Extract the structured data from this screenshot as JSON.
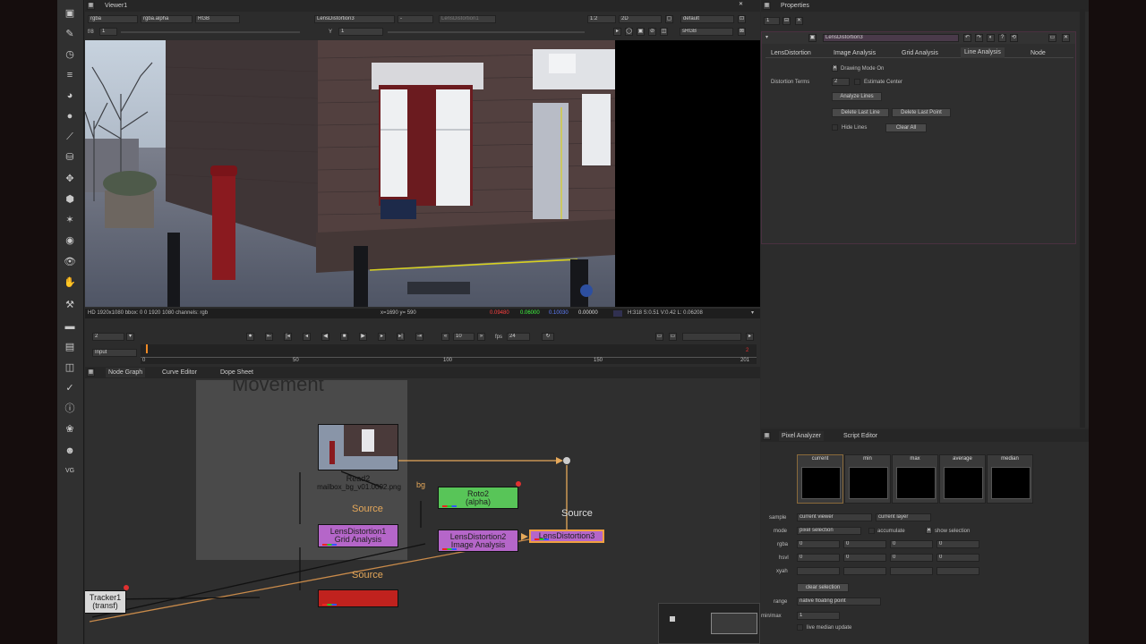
{
  "viewer": {
    "tab": "Viewer1",
    "channels": "rgba",
    "alpha": "rgba.alpha",
    "colorspace": "RGB",
    "input_a": "LensDistortion3",
    "input_b": "-",
    "input_b2": "LensDistortion1",
    "zoom": "1:2",
    "frames": "2D",
    "lut": "default",
    "gain_label": "f/8",
    "gain_value": "1",
    "gamma_label": "Y",
    "gamma_value": "1",
    "viewer_lut": "sRGB",
    "info_format": "HD 1920x1080  bbox: 0 0 1920 1080  channels: rgb",
    "info_coords": "x=1690 y= 590",
    "info_r": "0.09480",
    "info_g": "0.06000",
    "info_b": "0.10030",
    "info_a": "0.00000",
    "info_hsvl": "H:318 S:0.51 V:0.42  L: 0.06208"
  },
  "timeline": {
    "frame": "2",
    "playback_fps_label": "fps",
    "fps": "24",
    "increment": "10",
    "range_mode": "Input",
    "ticks": [
      "0",
      "50",
      "100",
      "150",
      "201"
    ],
    "end_frame": "2",
    "end_frame2": "201"
  },
  "node_panel": {
    "tabs": [
      "Node Graph",
      "Curve Editor",
      "Dope Sheet"
    ],
    "backdrop_label": "Movement",
    "nodes": {
      "read2_label": "Read2",
      "read2_file": "mailbox_bg_v01.0002.png",
      "roto2_name": "Roto2",
      "roto2_sub": "(alpha)",
      "lens1_name": "LensDistortion1",
      "lens1_sub": "Grid Analysis",
      "lens2_name": "LensDistortion2",
      "lens2_sub": "Image Analysis",
      "lens3_name": "LensDistortion3",
      "tracker1_name": "Tracker1",
      "tracker1_sub": "(transf)"
    },
    "edge_labels": {
      "source1": "Source",
      "source2": "Source",
      "source3": "Source",
      "bg": "bg"
    }
  },
  "properties": {
    "title": "Properties",
    "count": "1",
    "node_name": "LensDistortion3",
    "tabs": [
      "LensDistortion",
      "Image Analysis",
      "Grid Analysis",
      "Line Analysis",
      "Node"
    ],
    "active_tab": "Line Analysis",
    "drawing_mode": "Drawing Mode On",
    "distortion_terms_label": "Distortion Terms",
    "distortion_terms_value": "2",
    "estimate_center": "Estimate Center",
    "analyze_lines": "Analyze Lines",
    "delete_last_line": "Delete Last Line",
    "delete_last_point": "Delete Last Point",
    "hide_lines": "Hide Lines",
    "clear_all": "Clear All"
  },
  "pixel_analyzer": {
    "tabs": [
      "Pixel Analyzer",
      "Script Editor"
    ],
    "swatches": [
      "current",
      "min",
      "max",
      "average",
      "median"
    ],
    "sample_label": "sample",
    "sample_value": "current viewer",
    "layer_value": "current layer",
    "mode_label": "mode",
    "mode_value": "pixel selection",
    "accumulate": "accumulate",
    "show_selection": "show selection",
    "rows": [
      {
        "label": "rgba",
        "values": [
          "0",
          "0",
          "0",
          "0"
        ]
      },
      {
        "label": "hsvl",
        "values": [
          "0",
          "0",
          "0",
          "0"
        ]
      },
      {
        "label": "xyah",
        "values": [
          "",
          "",
          "",
          ""
        ]
      }
    ],
    "clear_selection": "clear selection",
    "range_label": "range",
    "range_value": "native floating point",
    "minmax_label": "min/max",
    "minmax_value": "1",
    "live_median": "live median update"
  },
  "toolbar": {
    "icons": [
      "viewer-icon",
      "paint-icon",
      "time-icon",
      "channel-icon",
      "color-icon",
      "filter-icon",
      "keyer-icon",
      "merge-icon",
      "transform-icon",
      "3d-icon",
      "particles-icon",
      "deep-icon",
      "views-icon",
      "metadata-icon",
      "toolsets-icon",
      "other-icon",
      "furnace-icon",
      "ofx-icon",
      "help-icon"
    ],
    "bottom_label": "VG"
  }
}
